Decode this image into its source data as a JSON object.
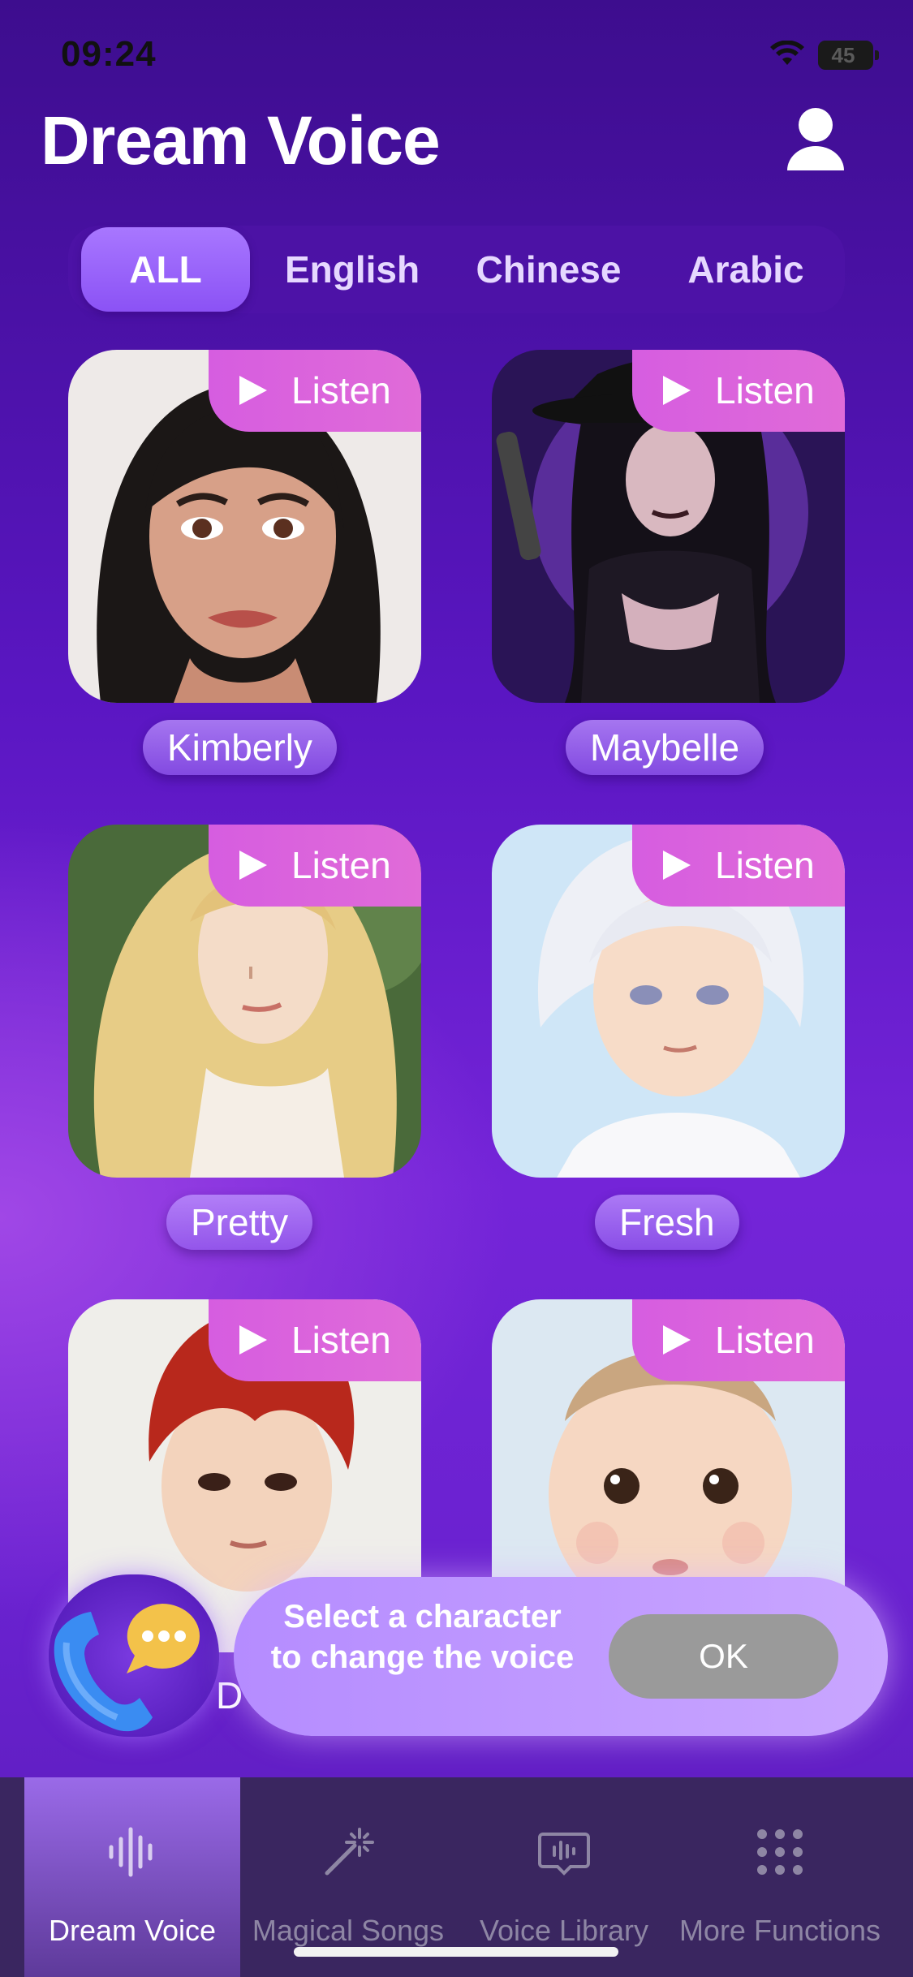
{
  "status_bar": {
    "time": "09:24",
    "battery": "45",
    "icons": [
      "wifi-icon",
      "battery-icon"
    ]
  },
  "header": {
    "title": "Dream Voice",
    "profile_icon": "person-icon"
  },
  "language_tabs": [
    {
      "label": "ALL",
      "active": true
    },
    {
      "label": "English",
      "active": false
    },
    {
      "label": "Chinese",
      "active": false
    },
    {
      "label": "Arabic",
      "active": false
    }
  ],
  "characters": [
    {
      "name": "Kimberly",
      "listen_label": "Listen"
    },
    {
      "name": "Maybelle",
      "listen_label": "Listen"
    },
    {
      "name": "Pretty",
      "listen_label": "Listen"
    },
    {
      "name": "Fresh",
      "listen_label": "Listen"
    },
    {
      "name": "",
      "listen_label": "Listen"
    },
    {
      "name": "",
      "listen_label": "Listen"
    }
  ],
  "partial_name_text": "D",
  "toast": {
    "message": "Select a character to change the voice",
    "ok_label": "OK"
  },
  "bottom_nav": [
    {
      "label": "Dream Voice",
      "icon": "waveform-icon",
      "active": true
    },
    {
      "label": "Magical Songs",
      "icon": "magic-wand-icon",
      "active": false
    },
    {
      "label": "Voice Library",
      "icon": "library-icon",
      "active": false
    },
    {
      "label": "More Functions",
      "icon": "grid-dots-icon",
      "active": false
    }
  ],
  "colors": {
    "accent": "#8b52f5",
    "listen_badge": "#e06bd8",
    "ok_button": "#9a9a9a",
    "tabbar": "#3a2660"
  }
}
